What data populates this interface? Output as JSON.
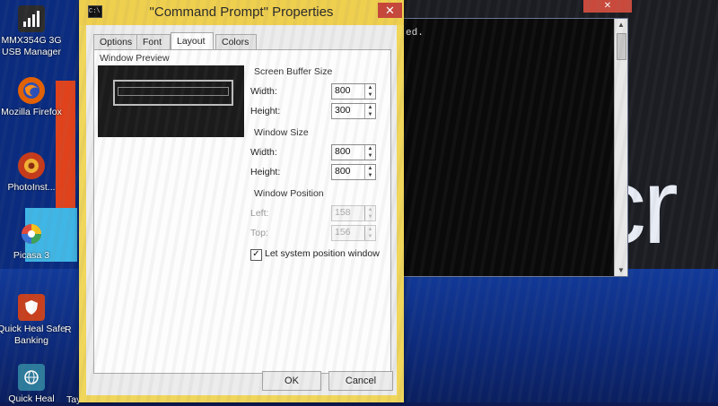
{
  "desktop": {
    "icons": [
      {
        "name": "mmx-usb-manager",
        "label": "MMX354G 3G USB Manager",
        "icon": "signal-bars-icon",
        "color": "#2b2b2b"
      },
      {
        "name": "mozilla-firefox",
        "label": "Mozilla Firefox",
        "icon": "firefox-icon",
        "color": "#e66000"
      },
      {
        "name": "photoinstrument",
        "label": "PhotoInst...",
        "icon": "photo-icon",
        "color": "#c63a1a"
      },
      {
        "name": "picasa",
        "label": "Picasa 3",
        "icon": "picasa-icon",
        "color": "#7b3fb0"
      },
      {
        "name": "quick-heal-safe-banking",
        "label": "Quick Heal Safe Banking",
        "icon": "shield-icon",
        "color": "#c8401e"
      },
      {
        "name": "quick-heal",
        "label": "Quick Heal",
        "icon": "globe-icon",
        "color": "#2c7b9c"
      },
      {
        "name": "partial-r",
        "label": "R"
      },
      {
        "name": "partial-taya",
        "label": "Taya drass"
      }
    ],
    "background_text": "cr"
  },
  "console": {
    "text": "ed."
  },
  "dialog": {
    "title": "\"Command Prompt\" Properties",
    "close_symbol": "✕",
    "tabs": [
      {
        "label": "Options",
        "active": false
      },
      {
        "label": "Font",
        "active": false
      },
      {
        "label": "Layout",
        "active": true
      },
      {
        "label": "Colors",
        "active": false
      }
    ],
    "preview_label": "Window Preview",
    "screen_buffer": {
      "label": "Screen Buffer Size",
      "width_label": "Width:",
      "width_value": "800",
      "height_label": "Height:",
      "height_value": "300"
    },
    "window_size": {
      "label": "Window Size",
      "width_label": "Width:",
      "width_value": "800",
      "height_label": "Height:",
      "height_value": "800"
    },
    "window_position": {
      "label": "Window Position",
      "left_label": "Left:",
      "left_value": "158",
      "top_label": "Top:",
      "top_value": "156"
    },
    "let_system_position": {
      "label": "Let system position window",
      "checked": true,
      "check_symbol": "✓"
    },
    "buttons": {
      "ok": "OK",
      "cancel": "Cancel"
    }
  },
  "colors": {
    "title_bar": "#efcf4e",
    "close_button": "#c7463a",
    "desktop_blue": "#0d2f8a"
  }
}
